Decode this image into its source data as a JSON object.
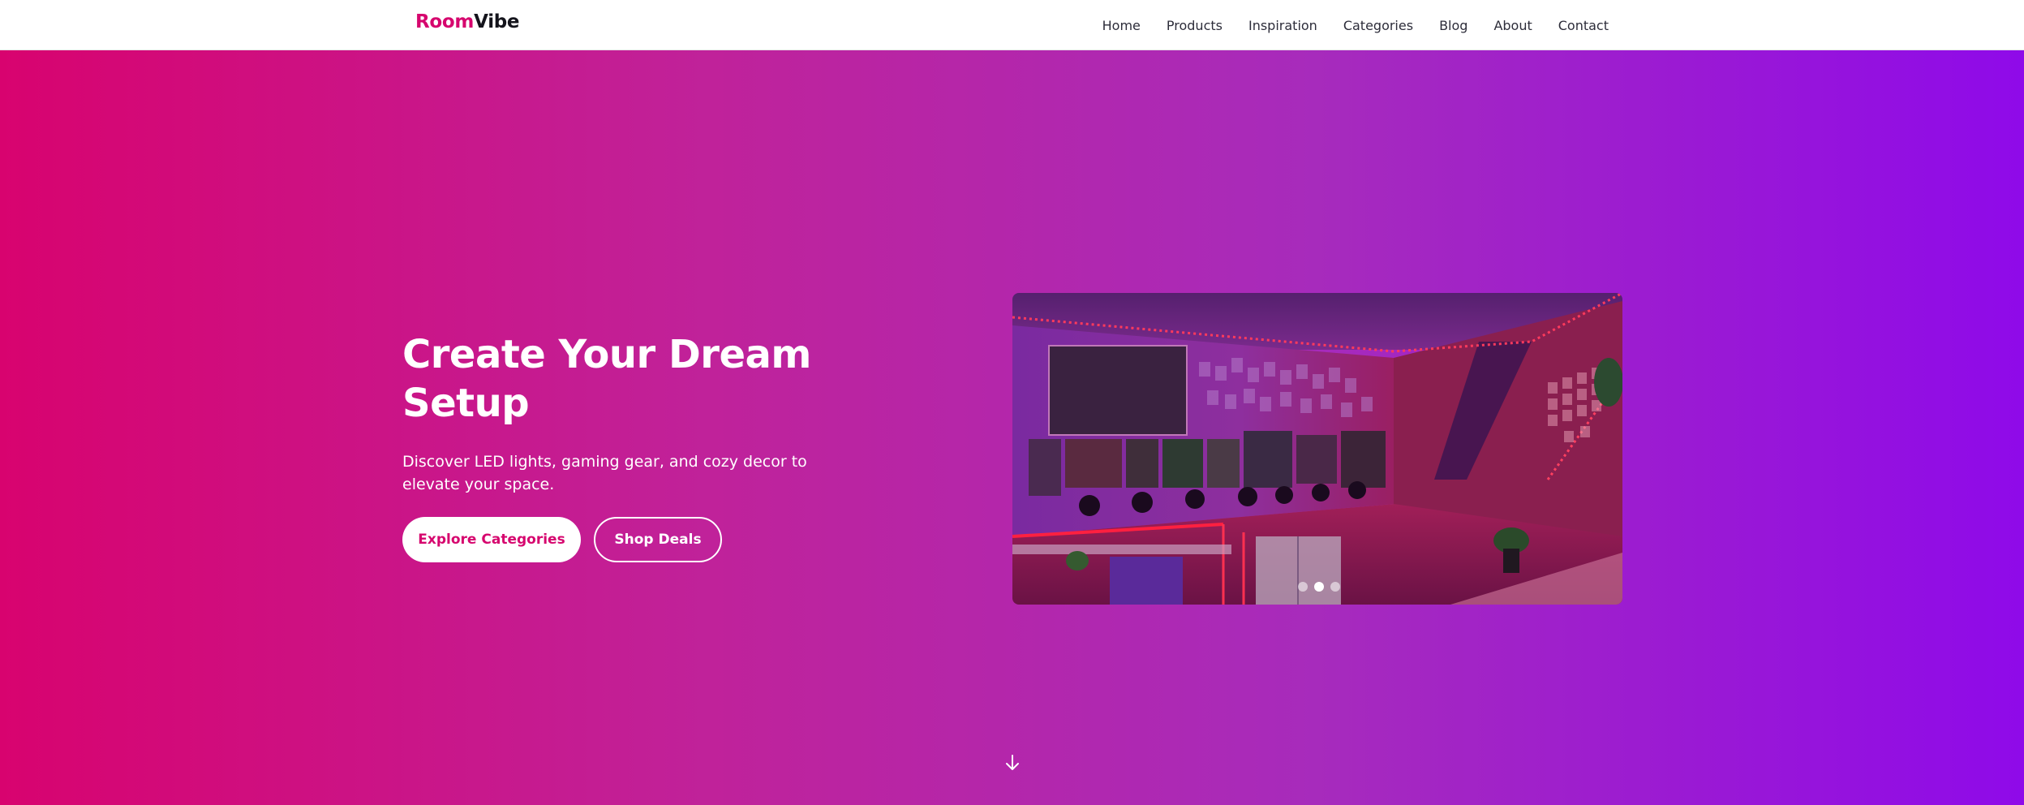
{
  "brand": {
    "part1": "Room",
    "part2": "Vibe"
  },
  "nav": {
    "items": [
      {
        "label": "Home"
      },
      {
        "label": "Products"
      },
      {
        "label": "Inspiration"
      },
      {
        "label": "Categories"
      },
      {
        "label": "Blog"
      },
      {
        "label": "About"
      },
      {
        "label": "Contact"
      }
    ]
  },
  "hero": {
    "title": "Create Your Dream Setup",
    "subtitle": "Discover LED lights, gaming gear, and cozy decor to elevate your space.",
    "primary_button": "Explore Categories",
    "secondary_button": "Shop Deals",
    "gradient_start": "#d8036f",
    "gradient_end": "#8f0ae9"
  },
  "carousel": {
    "slide_count": 3,
    "active_index": 1
  },
  "colors": {
    "brand_pink": "#d6066e",
    "text_dark": "#14141c"
  },
  "icons": {
    "scroll": "arrow-down-icon"
  }
}
